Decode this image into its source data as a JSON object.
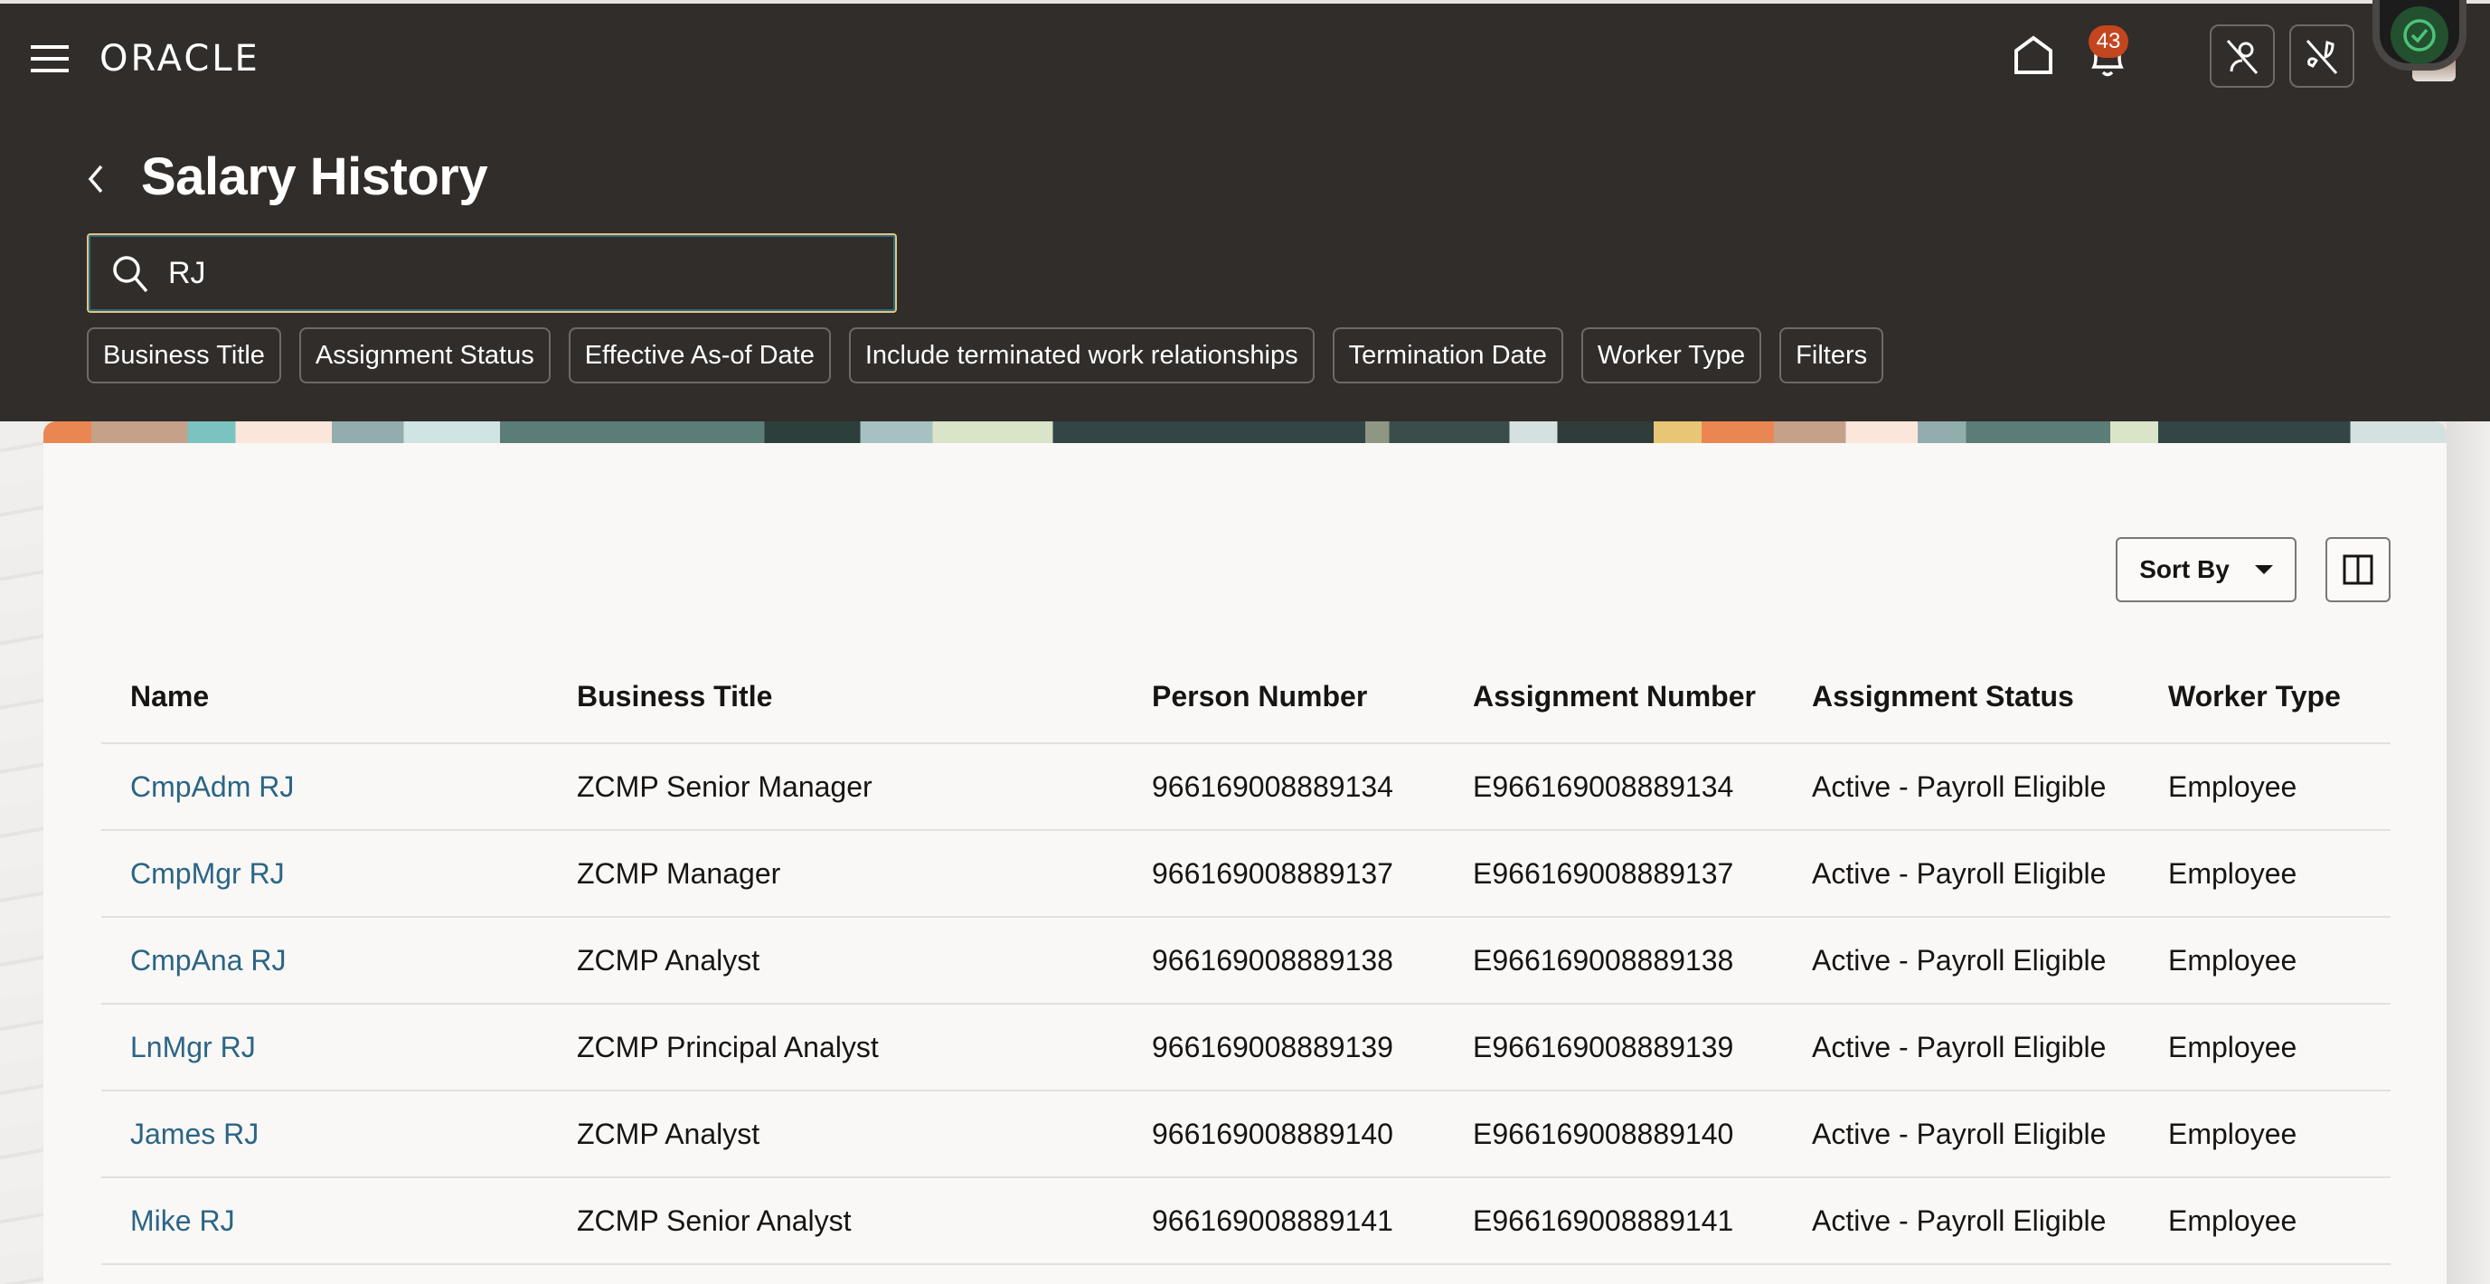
{
  "app": {
    "brand": "ORACLE",
    "notification_count": "43",
    "icons": {
      "menu": "hamburger-menu-icon",
      "home": "home-icon",
      "notifications": "bell-icon",
      "person_off": "person-off-icon",
      "phone_off": "phone-off-icon",
      "status": "check-circle-icon"
    }
  },
  "page": {
    "title": "Salary History",
    "back_icon": "chevron-left-icon"
  },
  "search": {
    "value": "RJ",
    "placeholder": ""
  },
  "filters": [
    {
      "label": "Business Title"
    },
    {
      "label": "Assignment Status"
    },
    {
      "label": "Effective As-of Date"
    },
    {
      "label": "Include terminated work relationships"
    },
    {
      "label": "Termination Date"
    },
    {
      "label": "Worker Type"
    },
    {
      "label": "Filters"
    }
  ],
  "toolbar": {
    "sort_label": "Sort By",
    "layout_icon": "column-layout-icon"
  },
  "table": {
    "columns": [
      "Name",
      "Business Title",
      "Person Number",
      "Assignment Number",
      "Assignment Status",
      "Worker Type"
    ],
    "rows": [
      {
        "name": "CmpAdm RJ",
        "business_title": "ZCMP Senior Manager",
        "person_number": "966169008889134",
        "assignment_number": "E966169008889134",
        "assignment_status": "Active - Payroll Eligible",
        "worker_type": "Employee"
      },
      {
        "name": "CmpMgr RJ",
        "business_title": "ZCMP Manager",
        "person_number": "966169008889137",
        "assignment_number": "E966169008889137",
        "assignment_status": "Active - Payroll Eligible",
        "worker_type": "Employee"
      },
      {
        "name": "CmpAna RJ",
        "business_title": "ZCMP Analyst",
        "person_number": "966169008889138",
        "assignment_number": "E966169008889138",
        "assignment_status": "Active - Payroll Eligible",
        "worker_type": "Employee"
      },
      {
        "name": "LnMgr RJ",
        "business_title": "ZCMP Principal Analyst",
        "person_number": "966169008889139",
        "assignment_number": "E966169008889139",
        "assignment_status": "Active - Payroll Eligible",
        "worker_type": "Employee"
      },
      {
        "name": "James RJ",
        "business_title": "ZCMP Analyst",
        "person_number": "966169008889140",
        "assignment_number": "E966169008889140",
        "assignment_status": "Active - Payroll Eligible",
        "worker_type": "Employee"
      },
      {
        "name": "Mike RJ",
        "business_title": "ZCMP Senior Analyst",
        "person_number": "966169008889141",
        "assignment_number": "E966169008889141",
        "assignment_status": "Active - Payroll Eligible",
        "worker_type": "Employee"
      }
    ]
  },
  "colors": {
    "header_bg": "#312d2a",
    "link": "#2b6585",
    "badge": "#c4461e",
    "search_focus": "#e4c47b",
    "status_ok": "#4cc27a"
  }
}
